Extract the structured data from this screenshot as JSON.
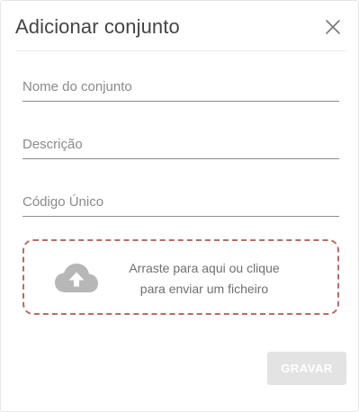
{
  "dialog": {
    "title": "Adicionar conjunto",
    "close_icon": "close-icon"
  },
  "form": {
    "name": {
      "placeholder": "Nome do conjunto",
      "value": ""
    },
    "description": {
      "placeholder": "Descrição",
      "value": ""
    },
    "code": {
      "placeholder": "Código Único",
      "value": ""
    }
  },
  "upload": {
    "icon": "cloud-upload-icon",
    "line1": "Arraste para aqui ou clique",
    "line2": "para enviar um ficheiro",
    "border_color": "#b86b66"
  },
  "actions": {
    "save_label": "GRAVAR",
    "save_enabled": false
  }
}
